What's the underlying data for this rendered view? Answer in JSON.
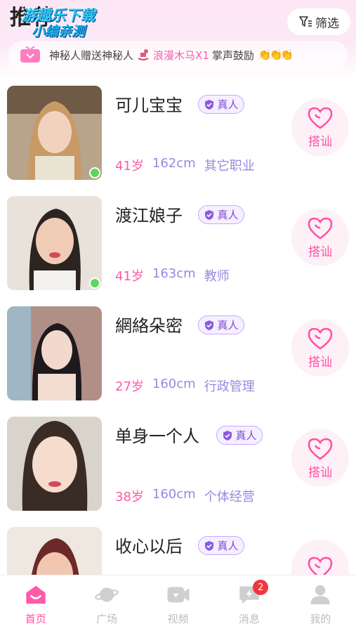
{
  "header": {
    "title": "推荐",
    "watermark_line1": "游趣乐下载",
    "watermark_line2": "小编亲测",
    "filter_label": "筛选"
  },
  "banner": {
    "sender": "神秘人",
    "verb": "赠送",
    "receiver": "神秘人",
    "gift_name": "浪漫木马X1",
    "message": "掌声鼓励",
    "emoji": "👏👏👏"
  },
  "users": [
    {
      "name": "可儿宝宝",
      "badge": "真人",
      "age": "41岁",
      "height": "162cm",
      "job": "其它职业",
      "online": true,
      "chat_label": "搭讪"
    },
    {
      "name": "渡江娘子",
      "badge": "真人",
      "age": "41岁",
      "height": "163cm",
      "job": "教师",
      "online": true,
      "chat_label": "搭讪"
    },
    {
      "name": "網絡朵密",
      "badge": "真人",
      "age": "27岁",
      "height": "160cm",
      "job": "行政管理",
      "online": false,
      "chat_label": "搭讪"
    },
    {
      "name": "单身一个人",
      "badge": "真人",
      "age": "38岁",
      "height": "160cm",
      "job": "个体经营",
      "online": false,
      "chat_label": "搭讪"
    },
    {
      "name": "收心以后",
      "badge": "真人",
      "age": "",
      "height": "",
      "job": "",
      "online": false,
      "chat_label": ""
    }
  ],
  "tabbar": {
    "tabs": [
      {
        "label": "首页",
        "icon": "home-icon",
        "active": true
      },
      {
        "label": "广场",
        "icon": "planet-icon",
        "active": false
      },
      {
        "label": "视频",
        "icon": "video-icon",
        "active": false
      },
      {
        "label": "消息",
        "icon": "message-icon",
        "active": false,
        "badge": "2"
      },
      {
        "label": "我的",
        "icon": "profile-icon",
        "active": false
      }
    ]
  },
  "colors": {
    "accent_pink": "#ff4fa3",
    "detail_purple": "#9a87e0",
    "badge_purple": "#7a4dd8",
    "online_green": "#5cd65c",
    "message_badge_red": "#f0373f"
  }
}
